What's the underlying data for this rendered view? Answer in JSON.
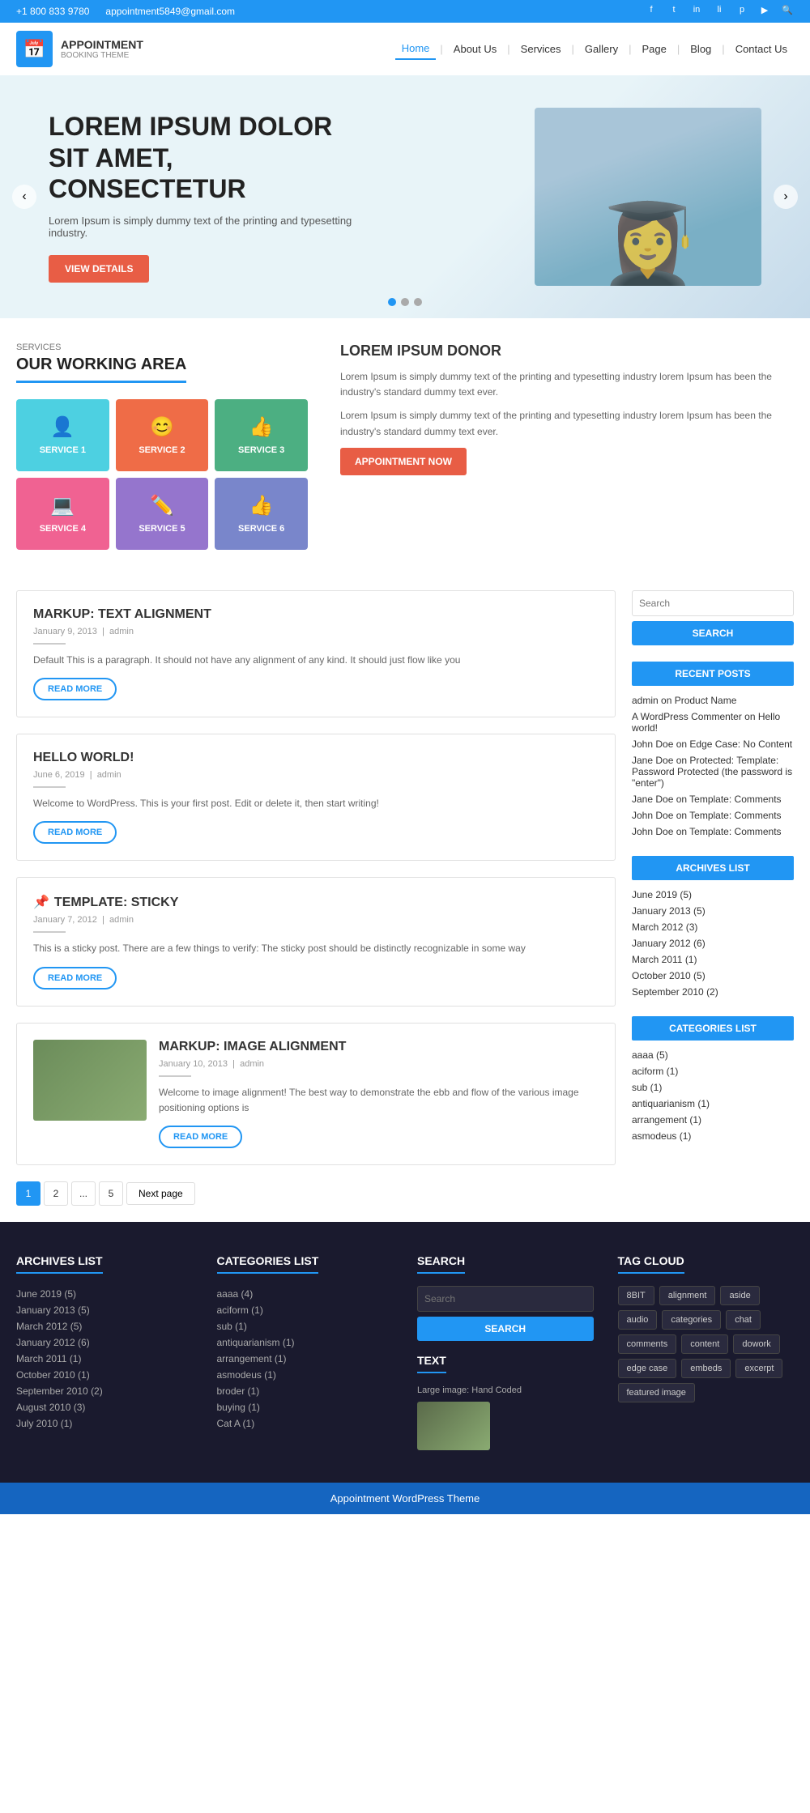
{
  "topbar": {
    "phone": "+1 800 833 9780",
    "email": "appointment5849@gmail.com",
    "social": [
      "facebook",
      "twitter",
      "instagram",
      "linkedin",
      "pinterest",
      "youtube",
      "search"
    ]
  },
  "header": {
    "logo_icon": "📅",
    "logo_name": "APPOINTMENT",
    "logo_sub": "BOOKING THEME",
    "nav": [
      {
        "label": "Home",
        "active": true
      },
      {
        "label": "About Us",
        "active": false
      },
      {
        "label": "Services",
        "active": false
      },
      {
        "label": "Gallery",
        "active": false
      },
      {
        "label": "Page",
        "active": false
      },
      {
        "label": "Blog",
        "active": false
      },
      {
        "label": "Contact Us",
        "active": false
      }
    ]
  },
  "hero": {
    "title": "LOREM IPSUM DOLOR SIT AMET, CONSECTETUR",
    "desc": "Lorem Ipsum is simply dummy text of the printing and typesetting industry.",
    "cta_label": "VIEW DETAILS",
    "prev_label": "‹",
    "next_label": "›"
  },
  "services_section": {
    "section_label": "SERVICES",
    "heading": "OUR WORKING AREA",
    "cards": [
      {
        "label": "SERVICE 1",
        "icon": "👤",
        "color": "#4dd0e1"
      },
      {
        "label": "SERVICE 2",
        "icon": "😊",
        "color": "#ef6c47"
      },
      {
        "label": "SERVICE 3",
        "icon": "👍",
        "color": "#4caf82"
      },
      {
        "label": "SERVICE 4",
        "icon": "💻",
        "color": "#f06292"
      },
      {
        "label": "SERVICE 5",
        "icon": "✏️",
        "color": "#9575cd"
      },
      {
        "label": "SERVICE 6",
        "icon": "👍",
        "color": "#7986cb"
      }
    ],
    "desc_title": "LOREM IPSUM DONOR",
    "desc_p1": "Lorem Ipsum is simply dummy text of the printing and typesetting industry lorem Ipsum has been the industry's standard dummy text ever.",
    "desc_p2": "Lorem Ipsum is simply dummy text of the printing and typesetting industry lorem Ipsum has been the industry's standard dummy text ever.",
    "appointment_btn": "APPOINTMENT NOW"
  },
  "posts": [
    {
      "title": "MARKUP: TEXT ALIGNMENT",
      "date": "January 9, 2013",
      "author": "admin",
      "excerpt": "Default This is a paragraph. It should not have any alignment of any kind. It should just flow like you",
      "read_more": "READ MORE",
      "sticky": false,
      "has_image": false
    },
    {
      "title": "HELLO WORLD!",
      "date": "June 6, 2019",
      "author": "admin",
      "excerpt": "Welcome to WordPress. This is your first post. Edit or delete it, then start writing!",
      "read_more": "READ MORE",
      "sticky": false,
      "has_image": false
    },
    {
      "title": "TEMPLATE: STICKY",
      "date": "January 7, 2012",
      "author": "admin",
      "excerpt": "This is a sticky post. There are a few things to verify: The sticky post should be distinctly recognizable in some way",
      "read_more": "READ MORE",
      "sticky": true,
      "has_image": false
    },
    {
      "title": "MARKUP: IMAGE ALIGNMENT",
      "date": "January 10, 2013",
      "author": "admin",
      "excerpt": "Welcome to image alignment! The best way to demonstrate the ebb and flow of the various image positioning options is",
      "read_more": "READ MORE",
      "sticky": false,
      "has_image": true
    }
  ],
  "pagination": {
    "pages": [
      "1",
      "2",
      "...",
      "5"
    ],
    "next_label": "Next page",
    "current": "1"
  },
  "sidebar": {
    "search_placeholder": "Search",
    "search_btn": "SEARCH",
    "recent_posts_title": "RECENT POSTS",
    "recent_posts": [
      "admin on Product Name",
      "A WordPress Commenter on Hello world!",
      "John Doe on Edge Case: No Content",
      "Jane Doe on Protected: Template: Password Protected (the password is \"enter\")",
      "Jane Doe on Template: Comments",
      "John Doe on Template: Comments",
      "John Doe on Template: Comments"
    ],
    "archives_title": "ARCHIVES LIST",
    "archives": [
      "June 2019 (5)",
      "January 2013 (5)",
      "March 2012 (3)",
      "January 2012 (6)",
      "March 2011 (1)",
      "October 2010 (5)",
      "September 2010 (2)"
    ],
    "categories_title": "CATEGORIES LIST",
    "categories": [
      "aaaa (5)",
      "aciform (1)",
      "sub (1)",
      "antiquarianism (1)",
      "arrangement (1)",
      "asmodeus (1)"
    ]
  },
  "footer_widgets": {
    "archives": {
      "title": "ARCHIVES LIST",
      "items": [
        "June 2019 (5)",
        "January 2013 (5)",
        "March 2012 (5)",
        "January 2012 (6)",
        "March 2011 (1)",
        "October 2010 (1)",
        "September 2010 (2)",
        "August 2010 (3)",
        "July 2010 (1)"
      ]
    },
    "categories": {
      "title": "CATEGORIES LIST",
      "items": [
        "aaaa (4)",
        "aciform (1)",
        "sub (1)",
        "antiquarianism (1)",
        "arrangement (1)",
        "asmodeus (1)",
        "broder (1)",
        "buying (1)",
        "Cat A (1)"
      ]
    },
    "search": {
      "title": "SEARCH",
      "placeholder": "Search",
      "btn_label": "SEARCH",
      "text_title": "TEXT",
      "text_label": "Large image: Hand Coded"
    },
    "tag_cloud": {
      "title": "TAG CLOUD",
      "tags": [
        "8BIT",
        "alignment",
        "aside",
        "audio",
        "categories",
        "chat",
        "comments",
        "content",
        "dowork",
        "edge case",
        "embeds",
        "excerpt",
        "featured image"
      ]
    }
  },
  "footer_bar": {
    "text": "Appointment WordPress Theme"
  }
}
